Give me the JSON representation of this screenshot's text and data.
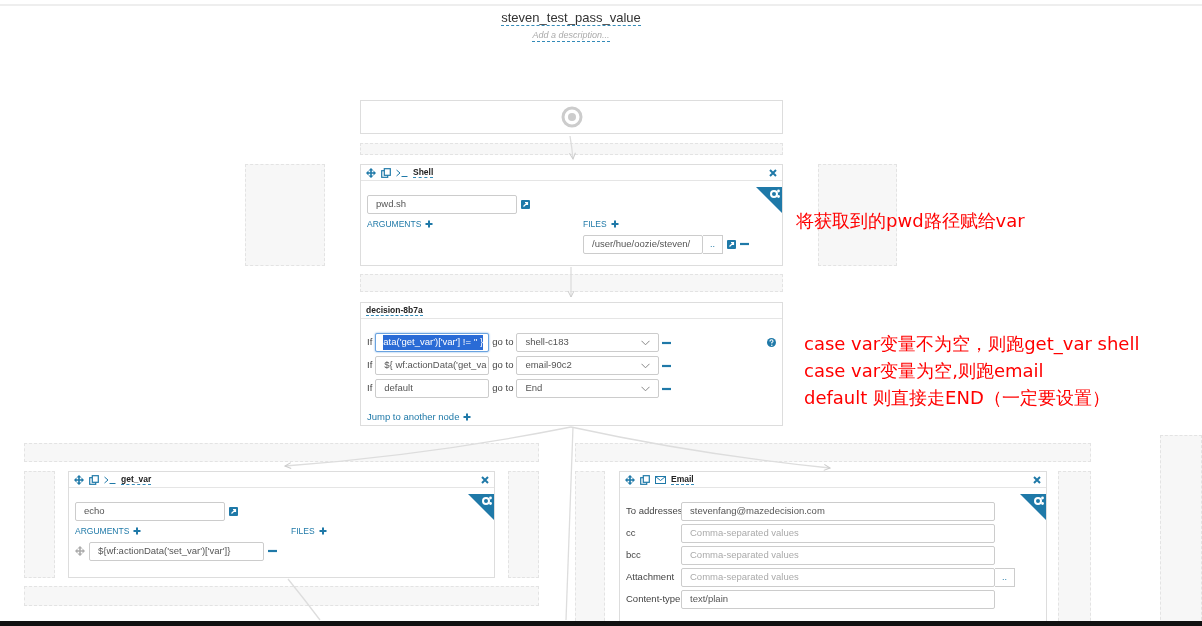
{
  "workflow": {
    "title": "steven_test_pass_value",
    "description_placeholder": "Add a description..."
  },
  "nodes": [
    {
      "kind": "start"
    },
    {
      "kind": "shell",
      "name": "Shell",
      "command": "pwd.sh",
      "arguments_label": "ARGUMENTS",
      "files_label": "FILES",
      "files": [
        {
          "value": "/user/hue/oozie/steven/",
          "browse": ".."
        }
      ]
    },
    {
      "kind": "decision",
      "name": "decision-8b7a",
      "cases": [
        {
          "if_label": "If",
          "condition": "ata('get_var')['var'] != '' }",
          "text_selected": true,
          "goto_label": "go to",
          "target": "shell-c183"
        },
        {
          "if_label": "If",
          "condition": "${ wf:actionData('get_va",
          "text_selected": false,
          "goto_label": "go to",
          "target": "email-90c2"
        },
        {
          "if_label": "If",
          "condition": "default",
          "text_selected": false,
          "goto_label": "go to",
          "target": "End"
        }
      ],
      "jump_link": "Jump to another node"
    },
    {
      "kind": "shell",
      "name": "get_var",
      "command": "echo",
      "arguments_label": "ARGUMENTS",
      "files_label": "FILES",
      "arguments": [
        "${wf:actionData('set_var')['var']}"
      ]
    },
    {
      "kind": "email",
      "name": "Email",
      "fields": [
        {
          "label": "To addresses",
          "value": "stevenfang@mazedecision.com"
        },
        {
          "label": "cc",
          "placeholder": "Comma-separated values"
        },
        {
          "label": "bcc",
          "placeholder": "Comma-separated values"
        },
        {
          "label": "Attachment",
          "placeholder": "Comma-separated values",
          "browse": ".."
        },
        {
          "label": "Content-type",
          "value": "text/plain"
        }
      ]
    }
  ],
  "annotations": [
    {
      "color": "#ff0000",
      "lines": [
        "将获取到的pwd路径赋给var"
      ]
    },
    {
      "color": "#ff0000",
      "lines": [
        "case var变量不为空，则跑get_var shell",
        "case var变量为空,则跑email",
        "default 则直接走END（一定要设置）"
      ]
    }
  ]
}
